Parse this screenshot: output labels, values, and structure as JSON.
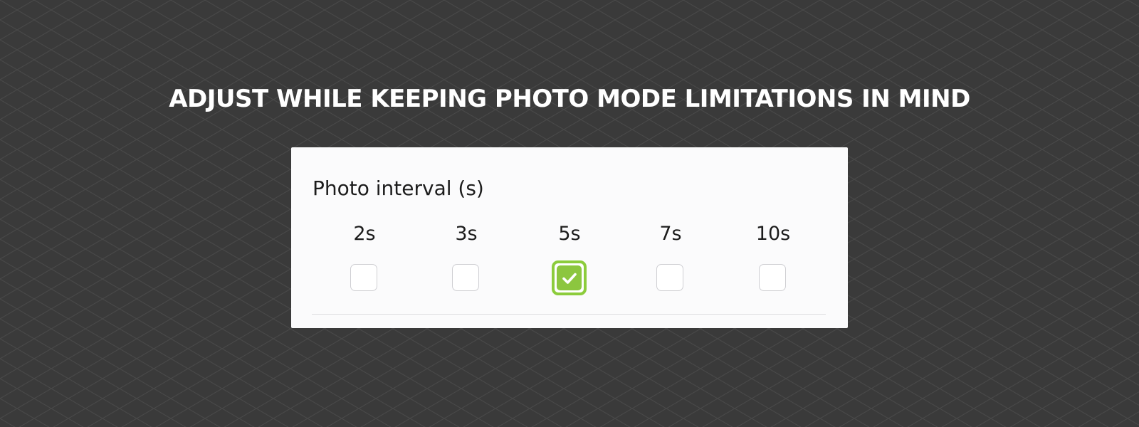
{
  "headline": "ADJUST WHILE KEEPING PHOTO MODE LIMITATIONS IN MIND",
  "photo_interval": {
    "label": "Photo interval (s)",
    "options": [
      {
        "label": "2s",
        "checked": false
      },
      {
        "label": "3s",
        "checked": false
      },
      {
        "label": "5s",
        "checked": true
      },
      {
        "label": "7s",
        "checked": false
      },
      {
        "label": "10s",
        "checked": false
      }
    ],
    "selected": "5s"
  },
  "colors": {
    "background": "#3a3a3a",
    "panel": "#fbfbfc",
    "accent_green": "#8cc63f",
    "headline_text": "#ffffff"
  },
  "icons": {
    "checked": "checkmark-icon"
  }
}
